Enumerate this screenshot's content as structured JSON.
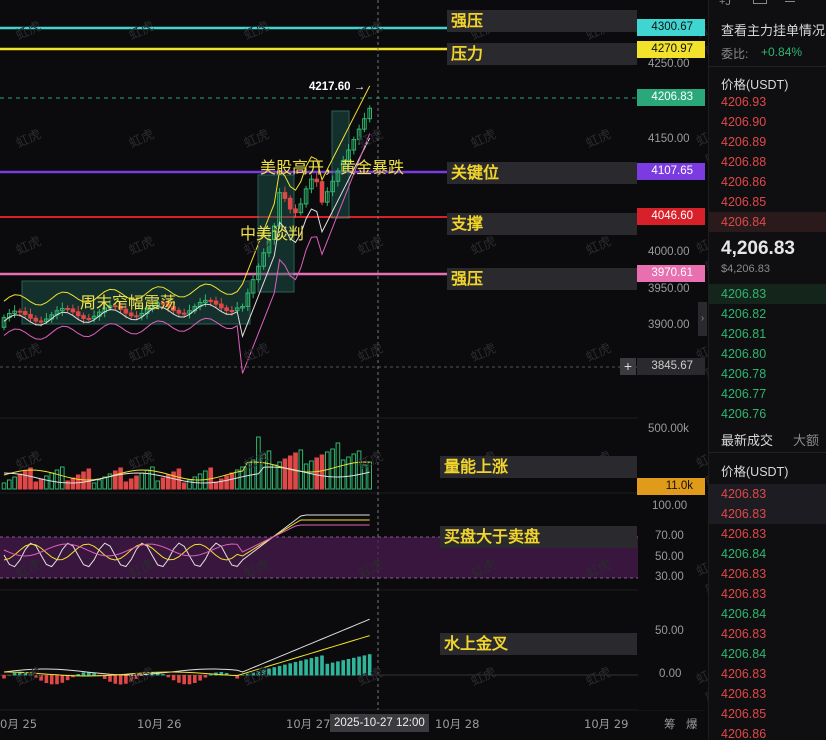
{
  "price_levels": {
    "strong_resistance_top": {
      "label": "强压",
      "value": "4300.67",
      "color": "#3fd6d2"
    },
    "resistance": {
      "label": "压力",
      "value": "4270.97",
      "color": "#f2e22b"
    },
    "current": {
      "value": "4206.83",
      "color": "#2aa87a"
    },
    "key_level": {
      "label": "关键位",
      "value": "4107.65",
      "color": "#7b3be0"
    },
    "support": {
      "label": "支撑",
      "value": "4046.60",
      "color": "#d8202a"
    },
    "strong_resistance_low": {
      "label": "强压",
      "value": "3970.61",
      "color": "#e870b0"
    },
    "crosshair": {
      "value": "3845.67"
    }
  },
  "price_axis": [
    "4250.00",
    "4150.00",
    "4000.00",
    "3950.00",
    "3900.00"
  ],
  "peak_label": "4217.60 →",
  "box_notes": {
    "weekend": "周末窄幅震荡",
    "talks": "中美谈判",
    "us_open": "美股高开，黄金暴跌"
  },
  "volume_panel": {
    "axis_top": "500.00k",
    "current": "11.0k",
    "label": "量能上涨"
  },
  "rsi_panel": {
    "axis": [
      "100.00",
      "70.00",
      "50.00",
      "30.00"
    ],
    "label": "买盘大于卖盘"
  },
  "macd_panel": {
    "axis": [
      "50.00",
      "0.00"
    ],
    "label": "水上金叉"
  },
  "x_axis": {
    "labels": [
      "0月 25",
      "10月 26",
      "10月 27",
      "10月 28",
      "10月 29"
    ],
    "crosshair": "2025-10-27 12:00",
    "corner": [
      "筹",
      "爆"
    ]
  },
  "watermark": "虹虎",
  "sidebar": {
    "top_icons": "+J",
    "title": "查看主力挂单情况",
    "ratio_label": "委比:",
    "ratio_value": "+0.84%",
    "price_header": "价格(USDT)",
    "asks": [
      "4206.93",
      "4206.90",
      "4206.89",
      "4206.88",
      "4206.86",
      "4206.85",
      "4206.84"
    ],
    "last_price": "4,206.83",
    "last_price_usd": "$4,206.83",
    "bids": [
      "4206.83",
      "4206.82",
      "4206.81",
      "4206.80",
      "4206.78",
      "4206.77",
      "4206.76"
    ],
    "tabs": [
      "最新成交",
      "大额"
    ],
    "trades_header": "价格(USDT)",
    "trades": [
      {
        "p": "4206.83",
        "c": "red"
      },
      {
        "p": "4206.83",
        "c": "red"
      },
      {
        "p": "4206.83",
        "c": "red"
      },
      {
        "p": "4206.84",
        "c": "green"
      },
      {
        "p": "4206.83",
        "c": "red"
      },
      {
        "p": "4206.83",
        "c": "red"
      },
      {
        "p": "4206.84",
        "c": "green"
      },
      {
        "p": "4206.83",
        "c": "red"
      },
      {
        "p": "4206.84",
        "c": "green"
      },
      {
        "p": "4206.83",
        "c": "red"
      },
      {
        "p": "4206.83",
        "c": "red"
      },
      {
        "p": "4206.85",
        "c": "red"
      },
      {
        "p": "4206.86",
        "c": "red"
      }
    ]
  }
}
